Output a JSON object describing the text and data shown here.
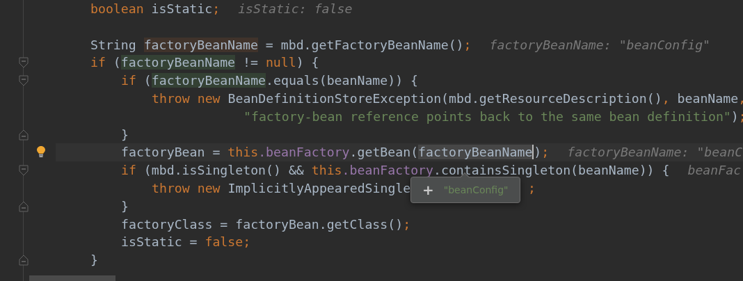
{
  "editor": {
    "lines": [
      {
        "tokens": [
          {
            "kind": "keyword",
            "text": "boolean"
          },
          {
            "kind": "plain",
            "text": " isStatic"
          },
          {
            "kind": "punct",
            "text": ";"
          },
          {
            "kind": "hint",
            "text": "isStatic: false"
          }
        ]
      },
      {
        "blank_before": true,
        "tokens": [
          {
            "kind": "plain",
            "text": "String "
          },
          {
            "kind": "plain",
            "text": "factoryBeanName",
            "written": true
          },
          {
            "kind": "plain",
            "text": " = mbd.getFactoryBeanName()"
          },
          {
            "kind": "punct",
            "text": ";"
          },
          {
            "kind": "hint",
            "text": "factoryBeanName: \"beanConfig\""
          }
        ]
      },
      {
        "fold_start": true,
        "tokens": [
          {
            "kind": "keyword",
            "text": "if"
          },
          {
            "kind": "plain",
            "text": " ("
          },
          {
            "kind": "plain",
            "text": "factoryBeanName",
            "read": true
          },
          {
            "kind": "plain",
            "text": " != "
          },
          {
            "kind": "keyword",
            "text": "null"
          },
          {
            "kind": "plain",
            "text": ") {"
          }
        ],
        "children": [
          {
            "fold_start": true,
            "tokens": [
              {
                "kind": "keyword",
                "text": "if"
              },
              {
                "kind": "plain",
                "text": " ("
              },
              {
                "kind": "plain",
                "text": "factoryBeanName",
                "read": true
              },
              {
                "kind": "plain",
                "text": ".equals(beanName)) {"
              }
            ],
            "children": [
              {
                "tokens": [
                  {
                    "kind": "keyword",
                    "text": "throw new"
                  },
                  {
                    "kind": "plain",
                    "text": " BeanDefinitionStoreException(mbd.getResourceDescription()"
                  },
                  {
                    "kind": "punct",
                    "text": ","
                  },
                  {
                    "kind": "plain",
                    "text": " beanName"
                  },
                  {
                    "kind": "punct",
                    "text": ","
                  }
                ],
                "children": [
                  {
                    "continuation": true,
                    "tokens": [
                      {
                        "kind": "string",
                        "text": "\"factory-bean reference points back to the same bean definition\""
                      },
                      {
                        "kind": "plain",
                        "text": ")"
                      },
                      {
                        "kind": "punct",
                        "text": ";"
                      }
                    ]
                  }
                ]
              }
            ]
          },
          {
            "fold_end": true,
            "tokens": [
              {
                "kind": "plain",
                "text": "}"
              }
            ]
          },
          {
            "current": true,
            "bulb": true,
            "tokens": [
              {
                "kind": "plain",
                "text": "factoryBean = "
              },
              {
                "kind": "keyword",
                "text": "this"
              },
              {
                "kind": "field",
                "text": ".beanFactory"
              },
              {
                "kind": "plain",
                "text": ".getBean("
              },
              {
                "kind": "plain",
                "text": "factoryBeanName",
                "selected": true,
                "caret": true
              },
              {
                "kind": "plain",
                "text": ")"
              },
              {
                "kind": "punct",
                "text": ";"
              },
              {
                "kind": "hint",
                "text": "factoryBeanName: \"beanC"
              }
            ]
          },
          {
            "fold_start": true,
            "tokens": [
              {
                "kind": "keyword",
                "text": "if"
              },
              {
                "kind": "plain",
                "text": " (mbd.isSingleton() && "
              },
              {
                "kind": "keyword",
                "text": "this"
              },
              {
                "kind": "field",
                "text": ".beanFactory"
              },
              {
                "kind": "plain",
                "text": ".containsSingleton(beanName)) {"
              },
              {
                "kind": "hint",
                "text": "beanFac"
              }
            ],
            "children": [
              {
                "tokens": [
                  {
                    "kind": "keyword",
                    "text": "throw new"
                  },
                  {
                    "kind": "plain",
                    "text": " ImplicitlyAppearedSingle"
                  },
                  {
                    "kind": "covered-punct",
                    "text": ";"
                  }
                ]
              }
            ]
          },
          {
            "fold_end": true,
            "tokens": [
              {
                "kind": "plain",
                "text": "}"
              }
            ]
          },
          {
            "tokens": [
              {
                "kind": "plain",
                "text": "factoryClass = factoryBean.getClass()"
              },
              {
                "kind": "punct",
                "text": ";"
              }
            ]
          },
          {
            "tokens": [
              {
                "kind": "plain",
                "text": "isStatic = "
              },
              {
                "kind": "keyword",
                "text": "false"
              },
              {
                "kind": "punct",
                "text": ";"
              }
            ]
          }
        ]
      },
      {
        "fold_end": true,
        "tokens": [
          {
            "kind": "plain",
            "text": "}"
          }
        ]
      }
    ]
  },
  "value_popup": {
    "action": "+",
    "value": "\"beanConfig\""
  }
}
